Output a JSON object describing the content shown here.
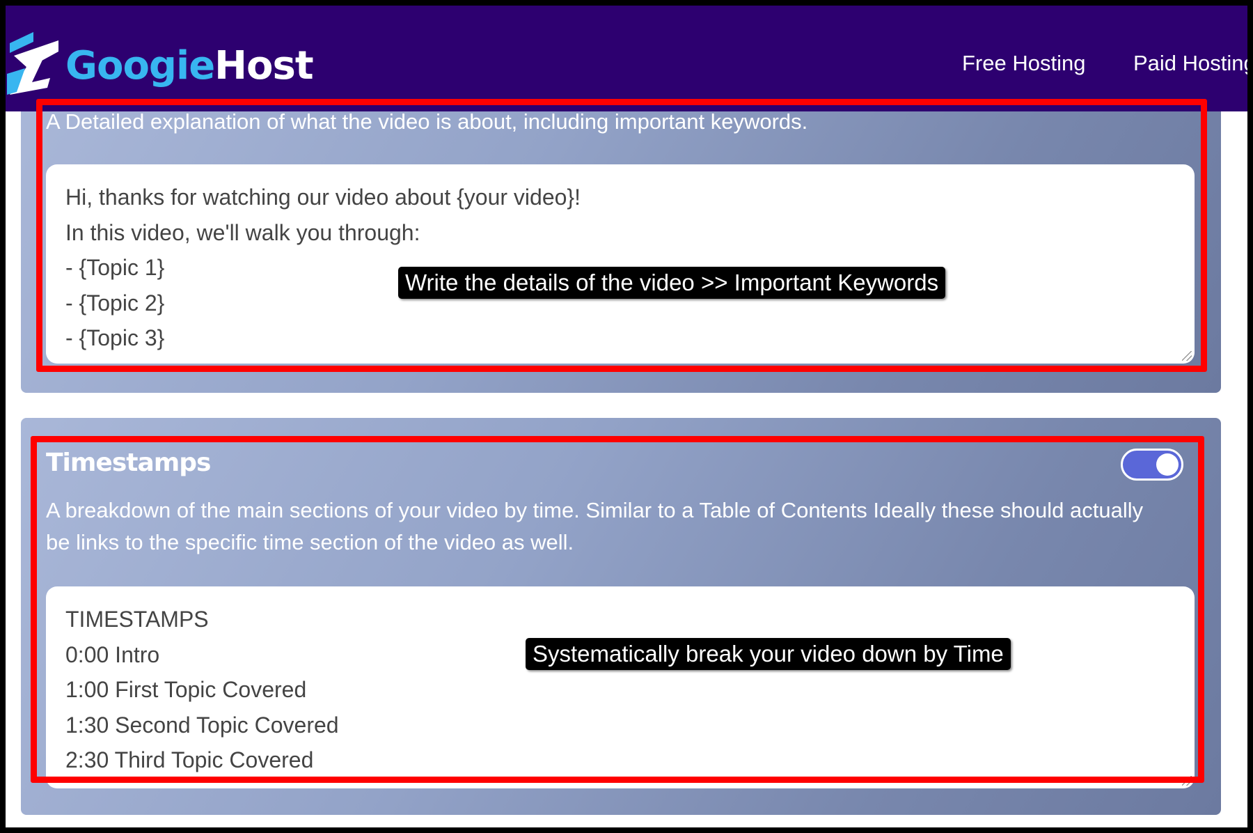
{
  "header": {
    "brand_part1": "Googie",
    "brand_part2": "Host",
    "nav": [
      "Free Hosting",
      "Paid Hosting"
    ]
  },
  "description_section": {
    "description": "A Detailed explanation of what the video is about, including important keywords.",
    "textarea_lines": [
      "Hi, thanks for watching our video about {your video}!",
      "In this video, we'll walk you through:",
      "- {Topic 1}",
      "- {Topic 2}",
      "- {Topic 3}"
    ],
    "annotation": "Write the details of the video >> Important Keywords"
  },
  "timestamps_section": {
    "title": "Timestamps",
    "toggle_on": true,
    "description": "A breakdown of the main sections of your video by time. Similar to a Table of Contents Ideally these should actually be links to the specific time section of the video as well.",
    "textarea_lines": [
      "TIMESTAMPS",
      "0:00 Intro",
      "1:00 First Topic Covered",
      "1:30 Second Topic Covered",
      "2:30 Third Topic Covered"
    ],
    "annotation": "Systematically break your video down by Time"
  },
  "colors": {
    "navbar": "#2d0070",
    "brand_accent": "#38b6f0",
    "annotation_red": "#ff0000",
    "toggle": "#5a67d8"
  }
}
